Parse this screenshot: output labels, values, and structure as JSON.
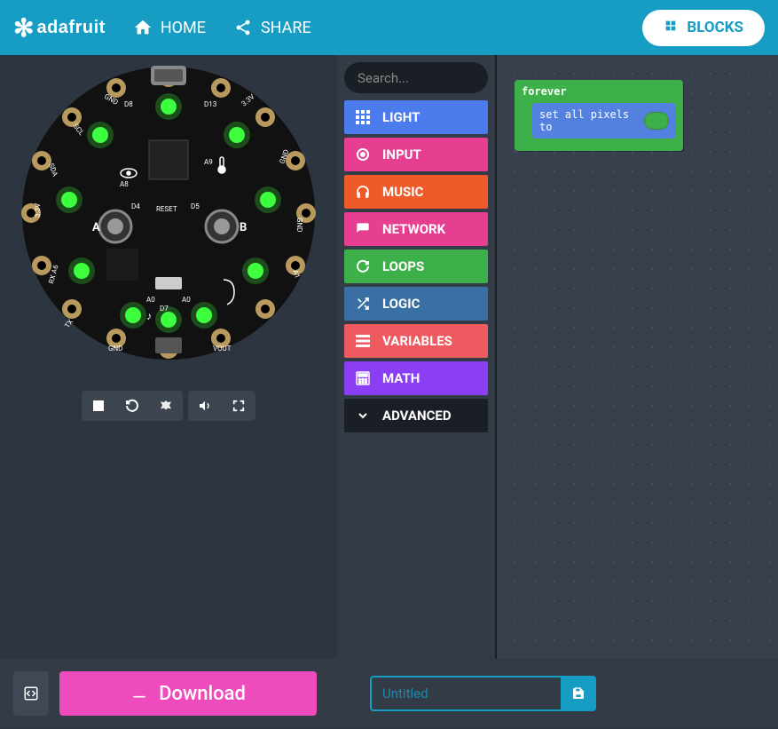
{
  "header": {
    "brand": "adafruit",
    "home": "HOME",
    "share": "SHARE",
    "blocks": "BLOCKS"
  },
  "toolbox": {
    "search_placeholder": "Search...",
    "categories": {
      "light": "LIGHT",
      "input": "INPUT",
      "music": "MUSIC",
      "network": "NETWORK",
      "loops": "LOOPS",
      "logic": "LOGIC",
      "variables": "VARIABLES",
      "math": "MATH",
      "advanced": "ADVANCED"
    }
  },
  "workspace": {
    "forever_label": "forever",
    "set_pixels_label": "set all pixels to",
    "pixel_color": "#3eb049"
  },
  "footer": {
    "download": "Download",
    "project_placeholder": "Untitled"
  },
  "board": {
    "pin_labels": [
      "D13",
      "3.3V",
      "D5",
      "GND",
      "A1",
      "A0",
      "VOUT",
      "GND",
      "TX",
      "RX",
      "A6",
      "3.3V",
      "SDA",
      "SCL",
      "GND",
      "D8"
    ],
    "inner_labels": [
      "A9",
      "D4",
      "RESET",
      "A8",
      "D7",
      "RX",
      "TX"
    ],
    "led_color": "#3eff3e"
  }
}
